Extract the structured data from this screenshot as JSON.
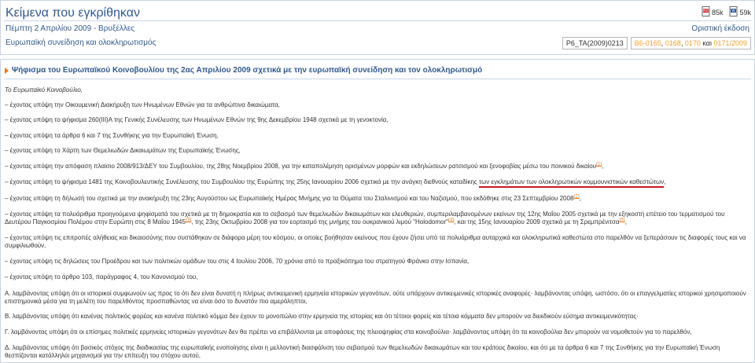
{
  "header": {
    "title": "Κείμενα που εγκρίθηκαν",
    "downloads": [
      {
        "icon": "pdf-icon",
        "size": "85k"
      },
      {
        "icon": "word-icon",
        "size": "59k"
      }
    ],
    "date": "Πέμπτη 2 Απριλίου 2009 - Βρυξέλλες",
    "final_label": "Οριστική έκδοση",
    "subject": "Ευρωπαϊκή συνείδηση και ολοκληρωτισμός",
    "reference": "P6_TA(2009)0213",
    "docs": {
      "d1": "B6-0165",
      "sep1": ", ",
      "d2": "0168",
      "sep2": ", ",
      "d3": "0170",
      "and": " και ",
      "d4": "0171/2009"
    }
  },
  "content": {
    "title": "Ψήφισμα του Ευρωπαϊκού Κοινοβουλίου της 2ας Απριλίου 2009 σχετικά με την ευρωπαϊκή συνείδηση και τον ολοκληρωτισμό",
    "intro": "Το Ευρωπαϊκό Κοινοβούλιο,",
    "items": [
      "–   έχοντας υπόψη την Οικουμενική Διακήρυξη των Ηνωμένων Εθνών για τα ανθρώπινα δικαιώματα,",
      "–   έχοντας υπόψη το ψήφισμα 260(III)A της Γενικής Συνέλευσης των Ηνωμένων Εθνών της 9ης Δεκεμβρίου 1948 σχετικά με τη γενοκτονία,",
      "–   έχοντας υπόψη τα άρθρα 6 και 7 της Συνθήκης για την Ευρωπαϊκή Ένωση,",
      "–   έχοντας υπόψη το Χάρτη των Θεμελιωδών Δικαιωμάτων της Ευρωπαϊκής Ένωσης,"
    ],
    "item5": {
      "text": "–   έχοντας υπόψη την απόφαση πλαίσιο 2008/913/ΔΕΥ του Συμβουλίου, της 28ης Νοεμβρίου 2008, για την καταπολέμηση ορισμένων μορφών και εκδηλώσεων ρατσισμού και ξενοφοβίας μέσω του ποινικού δικαίου",
      "fn": "(1)",
      "end": ","
    },
    "item6": {
      "text": "–   έχοντας υπόψη το ψήφισμα 1481 της Κοινοβουλευτικής Συνέλευσης του Συμβουλίου της Ευρώπης της 25ης Ιανουαρίου 2006 σχετικά με την ανάγκη διεθνούς καταδίκης ",
      "highlight": "των εγκλημάτων των ολοκληρωτικών κομμουνιστικών καθεστώτων",
      "end": ","
    },
    "item7": {
      "text": "–   έχοντας υπόψη τη δήλωσή του σχετικά με την ανακήρυξη της 23ης Αυγούστου ως Ευρωπαϊκής Ημέρας Μνήμης για τα Θύματα του Σταλινισμού και του Ναζισμού, που εκδόθηκε στις 23 Σεπτεμβρίου 2008",
      "fn": "(2)",
      "end": ","
    },
    "item8": {
      "a": "–   έχοντας υπόψη τα πολυάριθμα προηγούμενα ψηφίσματά του σχετικά με τη δημοκρατία και το σεβασμό των θεμελιωδών δικαιωμάτων και ελευθεριών, συμπεριλαμβανομένων εκείνων της 12ης Μαΐου 2005 σχετικά με την εξηκοστή επέτειο του τερματισμού του Δευτέρου Παγκοσμίου Πολέμου στην Ευρώπη στις 8 Μαΐου 1945",
      "fn1": "(3)",
      "b": ", της 23ης Οκτωβρίου 2008 για τον εορτασμό της μνήμης του ουκρανικού λιμού \"Holodomor\"",
      "fn2": "(4)",
      "c": ", και της 15ης Ιανουαρίου 2009 σχετικά με τη Σρεμπρένιτσα",
      "fn3": "(5)",
      "end": ","
    },
    "item9": "–   έχοντας υπόψη τις επιτροπές αλήθειας και δικαιοσύνης που συστάθηκαν σε διάφορα μέρη του κόσμου, οι οποίες βοήθησαν εκείνους που έχουν ζήσει υπό τα πολυάριθμα αυταρχικά και ολοκληρωτικά καθεστώτα στο παρελθόν να ξεπεράσουν τις διαφορές τους και να συμφιλιωθούν,",
    "item10": "–   έχοντας υπόψη τις δηλώσεις του Προέδρου και των πολιτικών ομάδων του στις 4 Ιουλίου 2006, 70 χρόνια από το πραξικόπημα του στρατηγού Φράνκο στην Ισπανία,",
    "item11": "–   έχοντας υπόψη το άρθρο 103, παράγραφος 4, του Κανονισμού του,",
    "itemA": "Α.   λαμβάνοντας υπόψη ότι οι ιστορικοί συμφωνούν ως προς το ότι δεν είναι δυνατή η πλήρως αντικειμενική ερμηνεία ιστορικών γεγονότων, ούτε υπάρχουν αντικειμενικές ιστορικές αναφορές· λαμβάνοντας υπόψη, ωστόσο, ότι οι επαγγελματίες ιστορικοί χρησιμοποιούν επιστημονικά μέσα για τη μελέτη του παρελθόντος προσπαθώντας να είναι όσο το δυνατόν πιο αμερόληπτοι,",
    "itemB": "Β.   λαμβάνοντας υπόψη ότι κανένας πολιτικός φορέας και κανένα πολιτικό κόμμα δεν έχουν το μονοπώλιο στην ερμηνεία της ιστορίας και ότι τέτοιοι φορείς και τέτοια κόμματα δεν μπορούν να διεκδικούν εύσημα αντικειμενικότητας·",
    "itemC": "Γ.   λαμβάνοντας υπόψη ότι οι επίσημες πολιτικές ερμηνείες ιστορικών γεγονότων δεν θα πρέπει να επιβάλλονται με αποφάσεις της πλειοψηφίας στα κοινοβούλια· λαμβάνοντας υπόψη ότι τα κοινοβούλια δεν μπορούν να νομοθετούν για το παρελθόν,",
    "itemD": "Δ.   λαμβάνοντας υπόψη ότι βασικός στόχος της διαδικασίας της ευρωπαϊκής ενοποίησης είναι η μελλοντική διασφάλιση του σεβασμού των θεμελιωδών δικαιωμάτων και του κράτους δικαίου, και ότι με τα άρθρα 6 και 7 της Συνθήκης για την Ευρωπαϊκή Ένωση θεσπίζονται κατάλληλοι μηχανισμοί για την επίτευξη του στόχου αυτού,"
  },
  "colors": {
    "accent": "#31598c",
    "link_orange": "#e17a1e",
    "doc_orange": "#f0a02a",
    "highlight_red": "#cc1a22"
  }
}
